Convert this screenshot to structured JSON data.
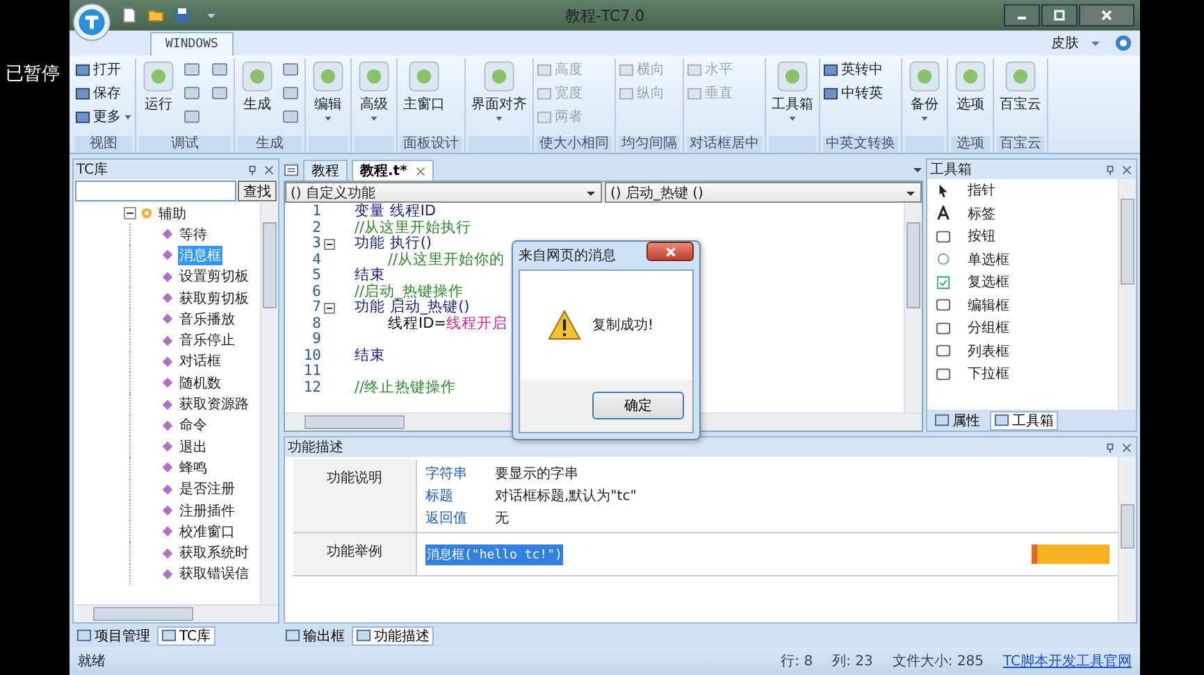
{
  "overlay": {
    "text": "已暂停"
  },
  "window": {
    "title": "教程-TC7.0"
  },
  "ribbon": {
    "tabs": [
      {
        "label": "WINDOWS",
        "selected": true
      }
    ],
    "skin": "皮肤",
    "groups": [
      {
        "label": "视图",
        "items": [
          {
            "kind": "small",
            "label": "打开",
            "disabled": false
          },
          {
            "kind": "small",
            "label": "保存",
            "disabled": false
          },
          {
            "kind": "small",
            "label": "更多",
            "disabled": false,
            "menu": true
          }
        ]
      },
      {
        "label": "调试",
        "items": [
          {
            "kind": "large",
            "label": "运行",
            "menu": false
          },
          {
            "kind": "tool"
          },
          {
            "kind": "tool"
          },
          {
            "kind": "tool"
          },
          {
            "kind": "tool"
          },
          {
            "kind": "tool"
          }
        ]
      },
      {
        "label": "生成",
        "items": [
          {
            "kind": "large",
            "label": "生成",
            "menu": false
          },
          {
            "kind": "tool"
          },
          {
            "kind": "tool"
          },
          {
            "kind": "tool"
          }
        ]
      },
      {
        "items": [
          {
            "kind": "large",
            "label": "编辑",
            "menu": true
          }
        ]
      },
      {
        "items": [
          {
            "kind": "large",
            "label": "高级",
            "menu": true
          }
        ]
      },
      {
        "label": "面板设计",
        "items": [
          {
            "kind": "large",
            "label": "主窗口",
            "menu": false
          }
        ]
      },
      {
        "items": [
          {
            "kind": "large",
            "label": "界面对齐",
            "menu": true
          }
        ]
      },
      {
        "label": "使大小相同",
        "items": [
          {
            "kind": "small",
            "label": "高度",
            "disabled": true
          },
          {
            "kind": "small",
            "label": "宽度",
            "disabled": true
          },
          {
            "kind": "small",
            "label": "两者",
            "disabled": true
          }
        ]
      },
      {
        "label": "均匀间隔",
        "items": [
          {
            "kind": "small",
            "label": "横向",
            "disabled": true
          },
          {
            "kind": "small",
            "label": "纵向",
            "disabled": true
          }
        ]
      },
      {
        "label": "对话框居中",
        "items": [
          {
            "kind": "small",
            "label": "水平",
            "disabled": true
          },
          {
            "kind": "small",
            "label": "垂直",
            "disabled": true
          }
        ]
      },
      {
        "items": [
          {
            "kind": "large",
            "label": "工具箱",
            "menu": true
          }
        ]
      },
      {
        "label": "中英文转换",
        "items": [
          {
            "kind": "small",
            "label": "英转中",
            "disabled": false
          },
          {
            "kind": "small",
            "label": "中转英",
            "disabled": false
          }
        ]
      },
      {
        "items": [
          {
            "kind": "large",
            "label": "备份",
            "menu": true
          }
        ]
      },
      {
        "label": "选项",
        "items": [
          {
            "kind": "large",
            "label": "选项",
            "menu": false
          }
        ]
      },
      {
        "label": "百宝云",
        "items": [
          {
            "kind": "large",
            "label": "百宝云",
            "menu": false
          }
        ]
      }
    ]
  },
  "library": {
    "title": "TC库",
    "search_button": "查找",
    "tree": [
      {
        "label": "辅助",
        "expanded": true,
        "children": [
          {
            "label": "等待",
            "selected": false
          },
          {
            "label": "消息框",
            "selected": true
          },
          {
            "label": "设置剪切板",
            "selected": false
          },
          {
            "label": "获取剪切板",
            "selected": false
          },
          {
            "label": "音乐播放",
            "selected": false
          },
          {
            "label": "音乐停止",
            "selected": false
          },
          {
            "label": "对话框",
            "selected": false
          },
          {
            "label": "随机数",
            "selected": false
          },
          {
            "label": "获取资源路",
            "selected": false
          },
          {
            "label": "命令",
            "selected": false
          },
          {
            "label": "退出",
            "selected": false
          },
          {
            "label": "蜂鸣",
            "selected": false
          },
          {
            "label": "是否注册",
            "selected": false
          },
          {
            "label": "注册插件",
            "selected": false
          },
          {
            "label": "校准窗口",
            "selected": false
          },
          {
            "label": "获取系统时",
            "selected": false
          },
          {
            "label": "获取错误信",
            "selected": false
          }
        ]
      }
    ],
    "tabs": [
      {
        "label": "项目管理",
        "selected": false
      },
      {
        "label": "TC库",
        "selected": true
      }
    ]
  },
  "editor": {
    "tabs": [
      {
        "label": "教程",
        "selected": false,
        "closable": false
      },
      {
        "label": "教程.t*",
        "selected": true,
        "closable": true
      }
    ],
    "dropdowns": [
      "() 自定义功能",
      "() 启动_热键 ()"
    ],
    "lines": [
      {
        "number": "1",
        "fold": false,
        "segments": [
          {
            "text": "变量 线程ID",
            "kind": "keyword"
          }
        ]
      },
      {
        "number": "2",
        "fold": false,
        "segments": [
          {
            "text": "//从这里开始执行",
            "kind": "comment"
          }
        ]
      },
      {
        "number": "3",
        "fold": true,
        "segments": [
          {
            "text": "功能 执行()",
            "kind": "keyword"
          }
        ],
        "children": [
          {
            "number": "4",
            "fold": false,
            "segments": [
              {
                "text": "//从这里开始你的",
                "kind": "comment"
              }
            ]
          }
        ]
      },
      {
        "number": "5",
        "fold": false,
        "segments": [
          {
            "text": "结束",
            "kind": "keyword"
          }
        ]
      },
      {
        "number": "6",
        "fold": false,
        "segments": [
          {
            "text": "//启动_热键操作",
            "kind": "comment"
          }
        ]
      },
      {
        "number": "7",
        "fold": true,
        "segments": [
          {
            "text": "功能 启动_热键()",
            "kind": "keyword"
          }
        ],
        "children": [
          {
            "number": "8",
            "fold": false,
            "segments": [
              {
                "text": "线程ID=",
                "kind": "plain"
              },
              {
                "text": "线程开启",
                "kind": "function"
              }
            ]
          },
          {
            "number": "9",
            "fold": false
          }
        ]
      },
      {
        "number": "10",
        "fold": false,
        "segments": [
          {
            "text": "结束",
            "kind": "keyword"
          }
        ]
      },
      {
        "number": "11",
        "fold": false
      },
      {
        "number": "12",
        "fold": false,
        "segments": [
          {
            "text": "//终止热键操作",
            "kind": "comment"
          }
        ]
      }
    ]
  },
  "dialog": {
    "title": "来自网页的消息",
    "message": "复制成功!",
    "button": "确定"
  },
  "toolbox": {
    "title": "工具箱",
    "items": [
      "指针",
      "标签",
      "按钮",
      "单选框",
      "复选框",
      "编辑框",
      "分组框",
      "列表框",
      "下拉框"
    ],
    "tabs": [
      {
        "label": "属性",
        "selected": false
      },
      {
        "label": "工具箱",
        "selected": true
      }
    ]
  },
  "description": {
    "title": "功能描述",
    "rows": [
      {
        "heading": "功能说明",
        "params": [
          {
            "name": "字符串",
            "text": "要显示的字串"
          },
          {
            "name": "标题",
            "text": "对话框标题,默认为\"tc\""
          },
          {
            "name": "返回值",
            "text": "无"
          }
        ]
      },
      {
        "heading": "功能举例",
        "example": "消息框(\"hello tc!\")"
      }
    ],
    "tabs": [
      {
        "label": "输出框",
        "selected": false
      },
      {
        "label": "功能描述",
        "selected": true
      }
    ]
  },
  "status_bar": {
    "text": "就绪",
    "line": "行: 8",
    "column": "列: 23",
    "size": "文件大小: 285",
    "link": "TC脚本开发工具官网"
  }
}
